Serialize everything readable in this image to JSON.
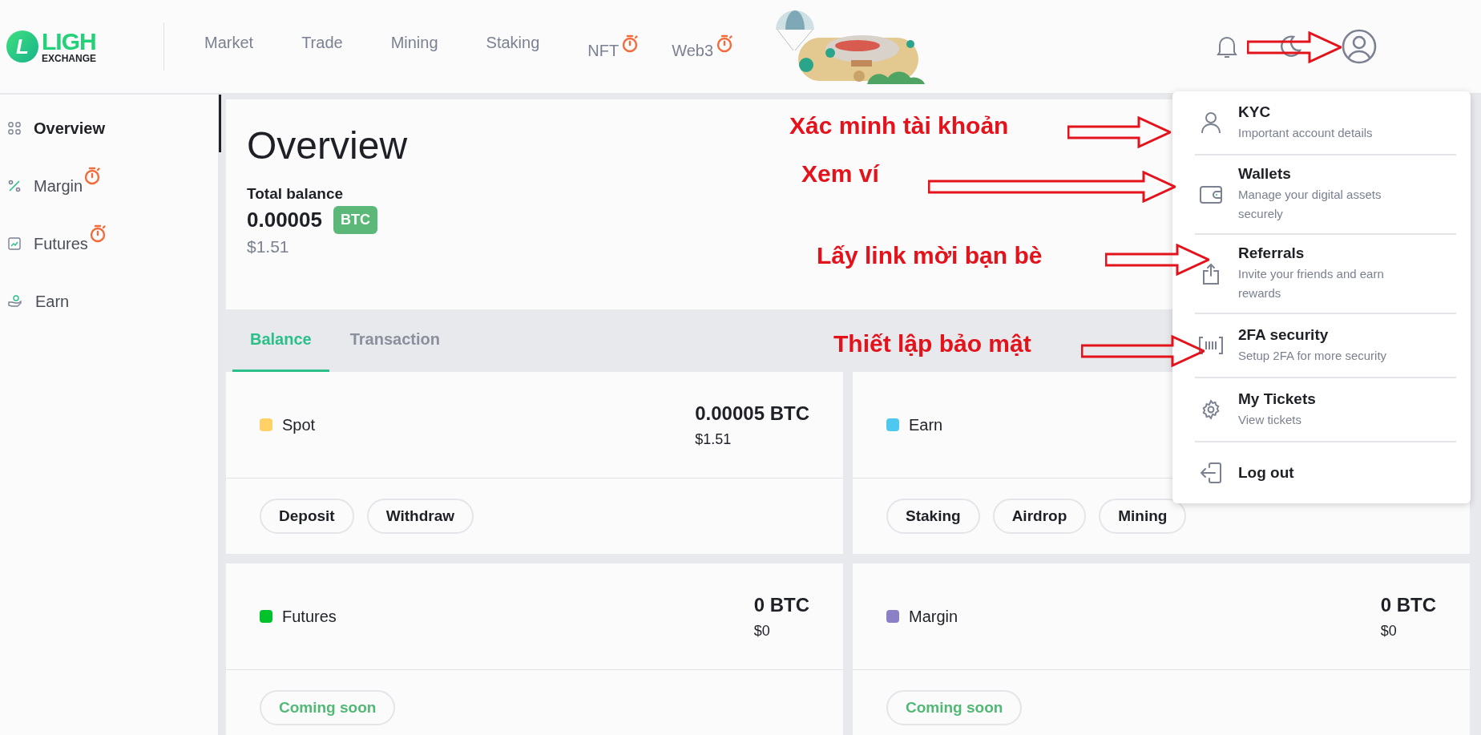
{
  "logo": {
    "mark": "L",
    "name": "LIGH",
    "sub": "EXCHANGE"
  },
  "nav": [
    {
      "label": "Market",
      "timer": false
    },
    {
      "label": "Trade",
      "timer": false
    },
    {
      "label": "Mining",
      "timer": false
    },
    {
      "label": "Staking",
      "timer": false
    },
    {
      "label": "NFT",
      "timer": true
    },
    {
      "label": "Web3",
      "timer": true
    }
  ],
  "sidebar": [
    {
      "label": "Overview",
      "selected": true,
      "timer": false
    },
    {
      "label": "Margin",
      "selected": false,
      "timer": true
    },
    {
      "label": "Futures",
      "selected": false,
      "timer": true
    },
    {
      "label": "Earn",
      "selected": false,
      "timer": false
    }
  ],
  "overview": {
    "title": "Overview",
    "balance_label": "Total balance",
    "amount": "0.00005",
    "currency": "BTC",
    "usd": "$1.51"
  },
  "tabs": [
    {
      "label": "Balance",
      "selected": true
    },
    {
      "label": "Transaction",
      "selected": false
    }
  ],
  "wallets": [
    {
      "name": "Spot",
      "color": "#ffd166",
      "amount": "0.00005 BTC",
      "usd": "$1.51",
      "buttons": [
        {
          "label": "Deposit",
          "kind": "action"
        },
        {
          "label": "Withdraw",
          "kind": "action"
        }
      ]
    },
    {
      "name": "Earn",
      "color": "#4fc8ef",
      "buttons": [
        {
          "label": "Staking",
          "kind": "action"
        },
        {
          "label": "Airdrop",
          "kind": "action"
        },
        {
          "label": "Mining",
          "kind": "action"
        }
      ]
    },
    {
      "name": "Futures",
      "color": "#00c22a",
      "amount": "0 BTC",
      "usd": "$0",
      "buttons": [
        {
          "label": "Coming soon",
          "kind": "soon"
        }
      ]
    },
    {
      "name": "Margin",
      "color": "#8b80c8",
      "amount": "0 BTC",
      "usd": "$0",
      "buttons": [
        {
          "label": "Coming soon",
          "kind": "soon"
        }
      ]
    }
  ],
  "menu": [
    {
      "title": "KYC",
      "subtitle": "Important account details"
    },
    {
      "title": "Wallets",
      "subtitle": "Manage your digital assets securely"
    },
    {
      "title": "Referrals",
      "subtitle": "Invite your friends and earn rewards"
    },
    {
      "title": "2FA security",
      "subtitle": "Setup 2FA for more security"
    },
    {
      "title": "My Tickets",
      "subtitle": "View tickets"
    },
    {
      "title": "Log out"
    }
  ],
  "annotations": [
    "Xác minh tài khoản",
    "Xem ví",
    "Lấy link mời bạn bè",
    "Thiết lập bảo mật"
  ]
}
